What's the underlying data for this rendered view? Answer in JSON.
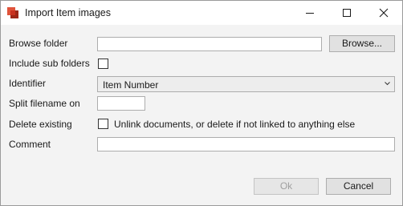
{
  "window": {
    "title": "Import Item images",
    "app_icon": "import-images-icon",
    "controls": {
      "minimize": "minimize-icon",
      "maximize": "maximize-icon",
      "close": "close-icon"
    }
  },
  "form": {
    "browse_folder": {
      "label": "Browse folder",
      "value": "",
      "button_label": "Browse..."
    },
    "include_sub_folders": {
      "label": "Include sub folders",
      "checked": false
    },
    "identifier": {
      "label": "Identifier",
      "selected": "Item Number",
      "arrow_icon": "chevron-down-icon"
    },
    "split_filename_on": {
      "label": "Split filename on",
      "value": ""
    },
    "delete_existing": {
      "label": "Delete existing",
      "checked": false,
      "option_text": "Unlink documents, or delete if not linked to anything else"
    },
    "comment": {
      "label": "Comment",
      "value": ""
    }
  },
  "footer": {
    "ok_label": "Ok",
    "ok_enabled": false,
    "cancel_label": "Cancel"
  },
  "colors": {
    "title_bar": "#ffffff",
    "dialog_background": "#f3f3f3",
    "button_face": "#e1e1e1",
    "disabled_text": "#a0a0a0",
    "icon_red": "#c8311f"
  }
}
